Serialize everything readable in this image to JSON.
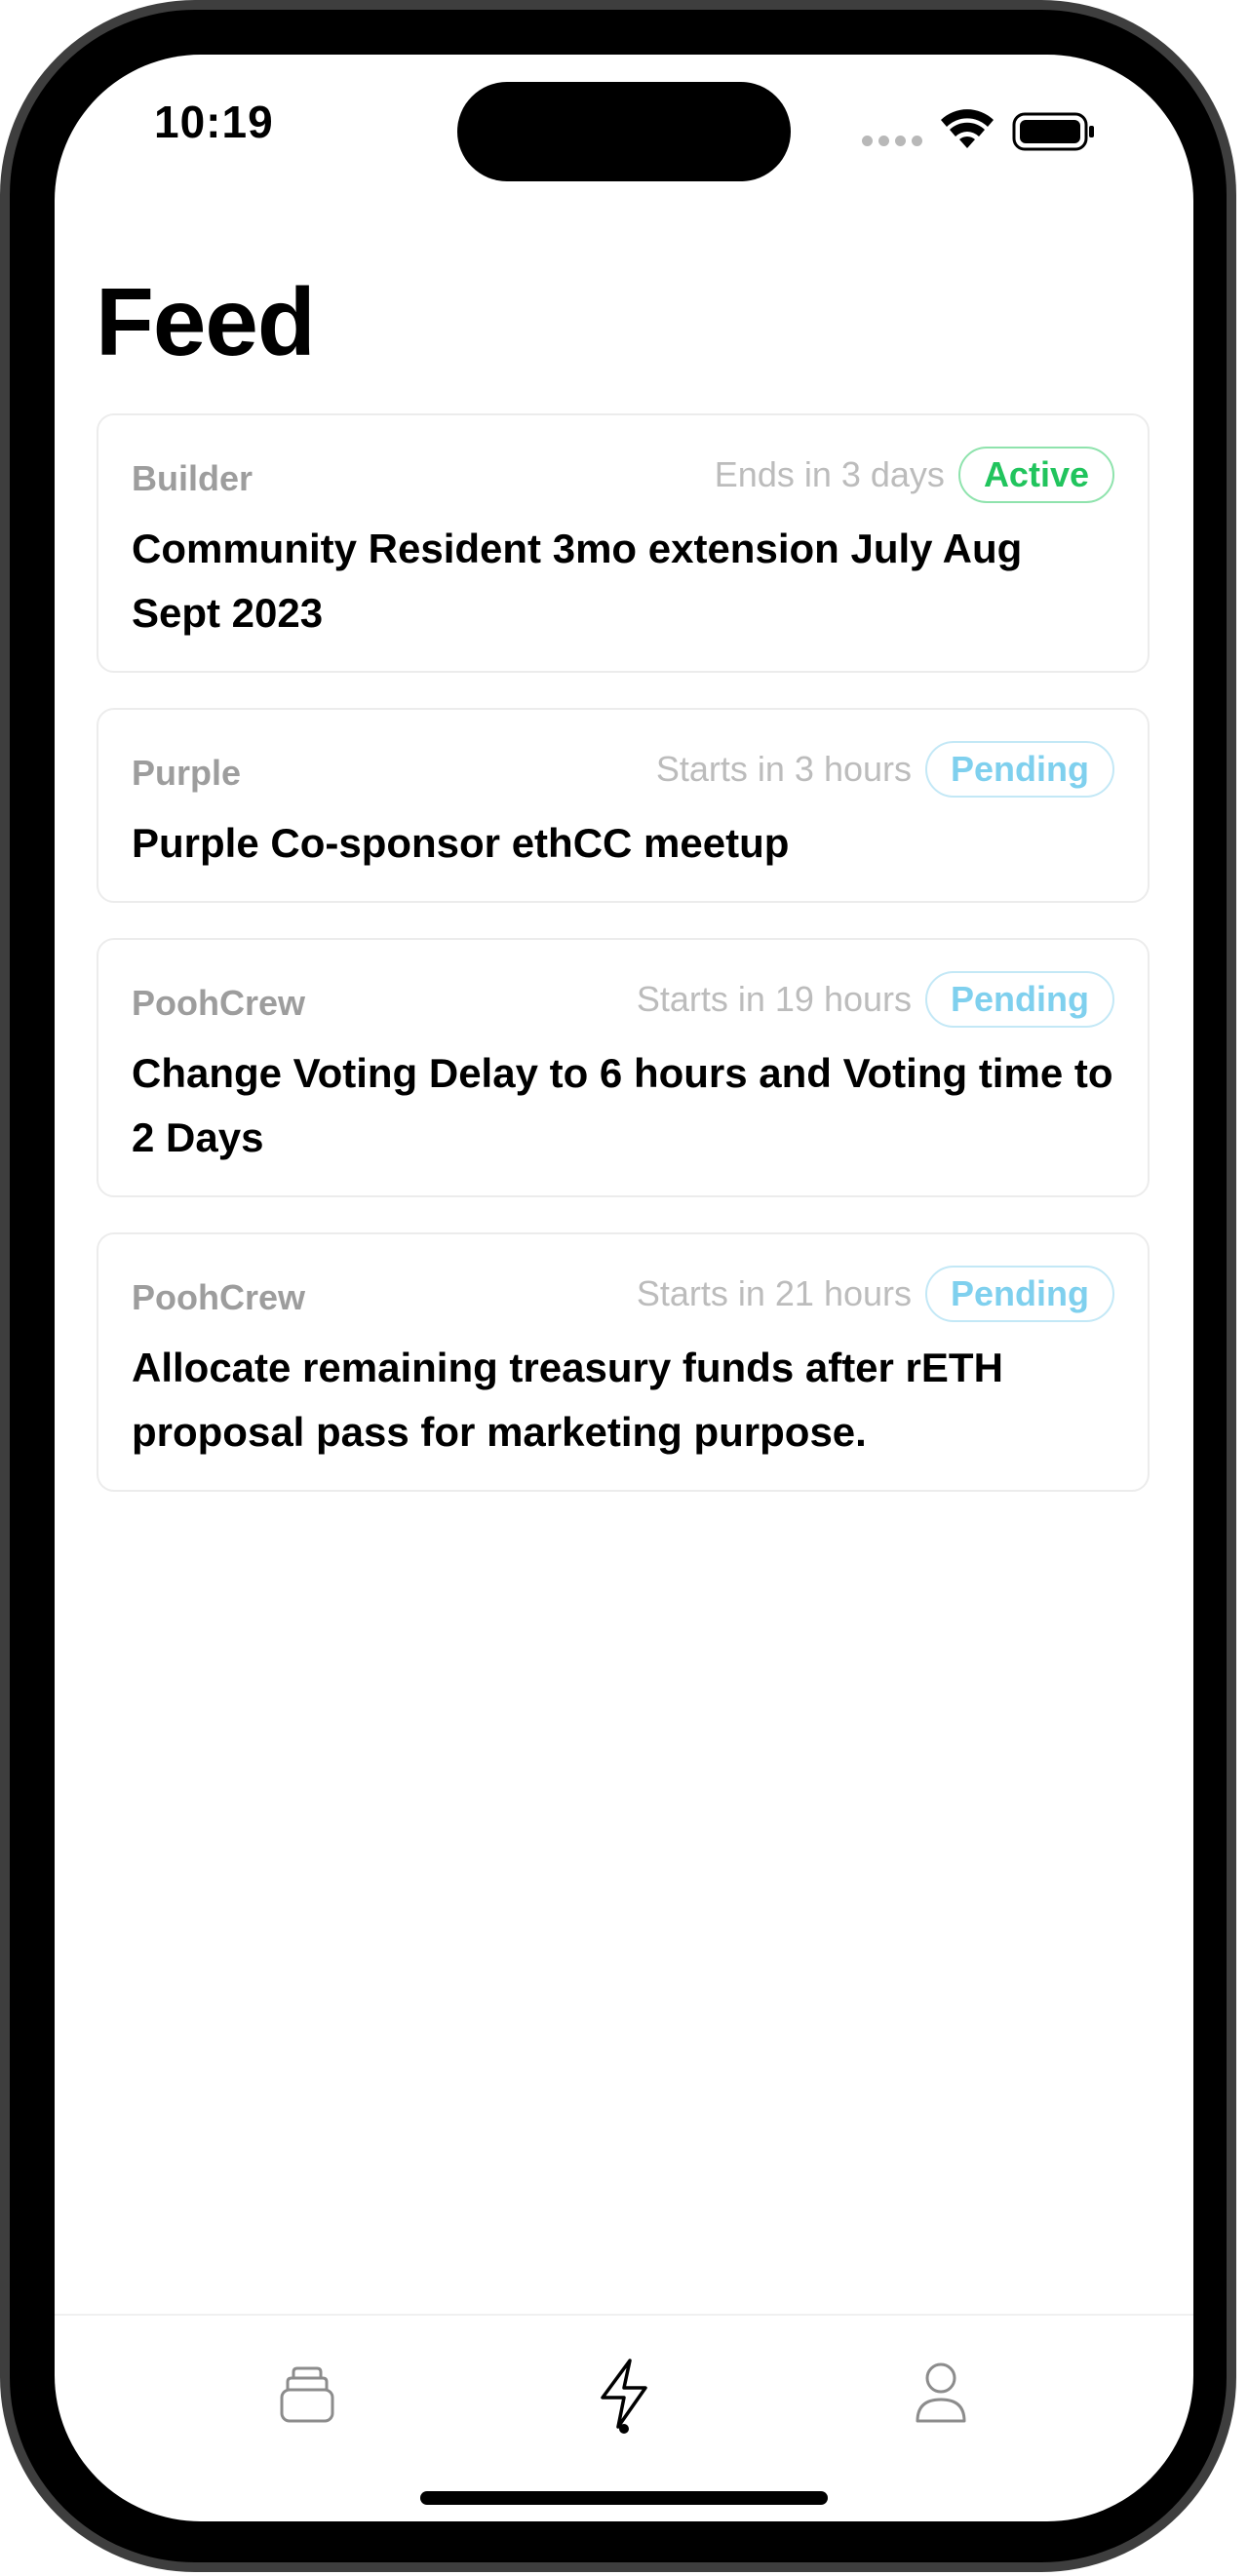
{
  "status_bar": {
    "time": "10:19"
  },
  "page": {
    "title": "Feed"
  },
  "proposals": [
    {
      "space": "Builder",
      "timing": "Ends in 3 days",
      "status": "Active",
      "title": "Community Resident 3mo extension July Aug Sept 2023"
    },
    {
      "space": "Purple",
      "timing": "Starts in 3 hours",
      "status": "Pending",
      "title": "Purple Co-sponsor ethCC meetup"
    },
    {
      "space": "PoohCrew",
      "timing": "Starts in 19 hours",
      "status": "Pending",
      "title": "Change Voting Delay to 6 hours and Voting time to 2 Days"
    },
    {
      "space": "PoohCrew",
      "timing": "Starts in 21 hours",
      "status": "Pending",
      "title": "Allocate remaining treasury funds after rETH proposal pass for marketing purpose."
    }
  ],
  "tab_bar": {
    "tabs": [
      {
        "icon": "stack-icon",
        "selected": false
      },
      {
        "icon": "lightning-icon",
        "selected": true
      },
      {
        "icon": "person-icon",
        "selected": false
      }
    ]
  },
  "colors": {
    "active": "#21c45d",
    "pending": "#7fd0ee",
    "muted_text": "#9d9d9d"
  }
}
